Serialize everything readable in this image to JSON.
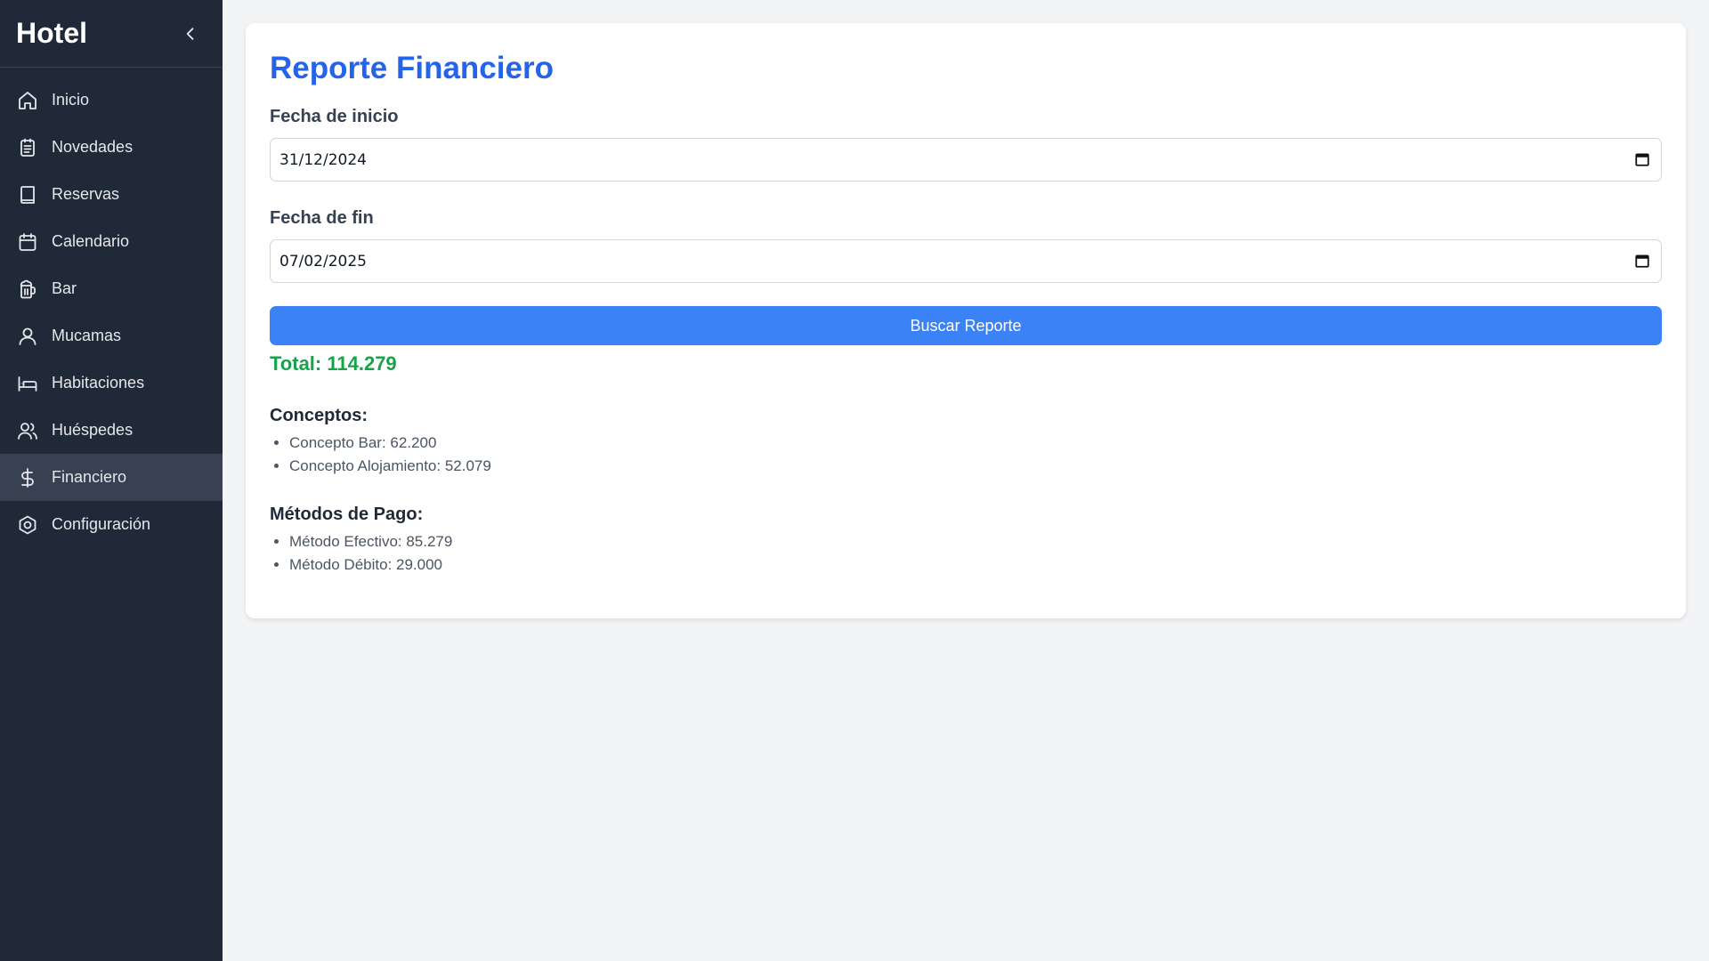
{
  "sidebar": {
    "brand": "Hotel",
    "items": [
      {
        "label": "Inicio",
        "icon": "home-icon"
      },
      {
        "label": "Novedades",
        "icon": "clipboard-icon"
      },
      {
        "label": "Reservas",
        "icon": "book-icon"
      },
      {
        "label": "Calendario",
        "icon": "calendar-icon"
      },
      {
        "label": "Bar",
        "icon": "beer-icon"
      },
      {
        "label": "Mucamas",
        "icon": "user-icon"
      },
      {
        "label": "Habitaciones",
        "icon": "bed-icon"
      },
      {
        "label": "Huéspedes",
        "icon": "users-icon"
      },
      {
        "label": "Financiero",
        "icon": "dollar-icon",
        "active": true
      },
      {
        "label": "Configuración",
        "icon": "settings-icon"
      }
    ]
  },
  "main": {
    "title": "Reporte Financiero",
    "start_label": "Fecha de inicio",
    "start_value": "31/12/2024",
    "end_label": "Fecha de fin",
    "end_value": "07/02/2025",
    "search_label": "Buscar Reporte",
    "total": "Total: 114.279",
    "concepts": {
      "title": "Conceptos:",
      "items": [
        "Concepto Bar: 62.200",
        "Concepto Alojamiento: 52.079"
      ]
    },
    "methods": {
      "title": "Métodos de Pago:",
      "items": [
        "Método Efectivo: 85.279",
        "Método Débito: 29.000"
      ]
    }
  },
  "colors": {
    "sidebar_bg": "#1f2937",
    "active_bg": "#374151",
    "title": "#2563eb",
    "button": "#3b82f6",
    "total": "#16a34a"
  }
}
